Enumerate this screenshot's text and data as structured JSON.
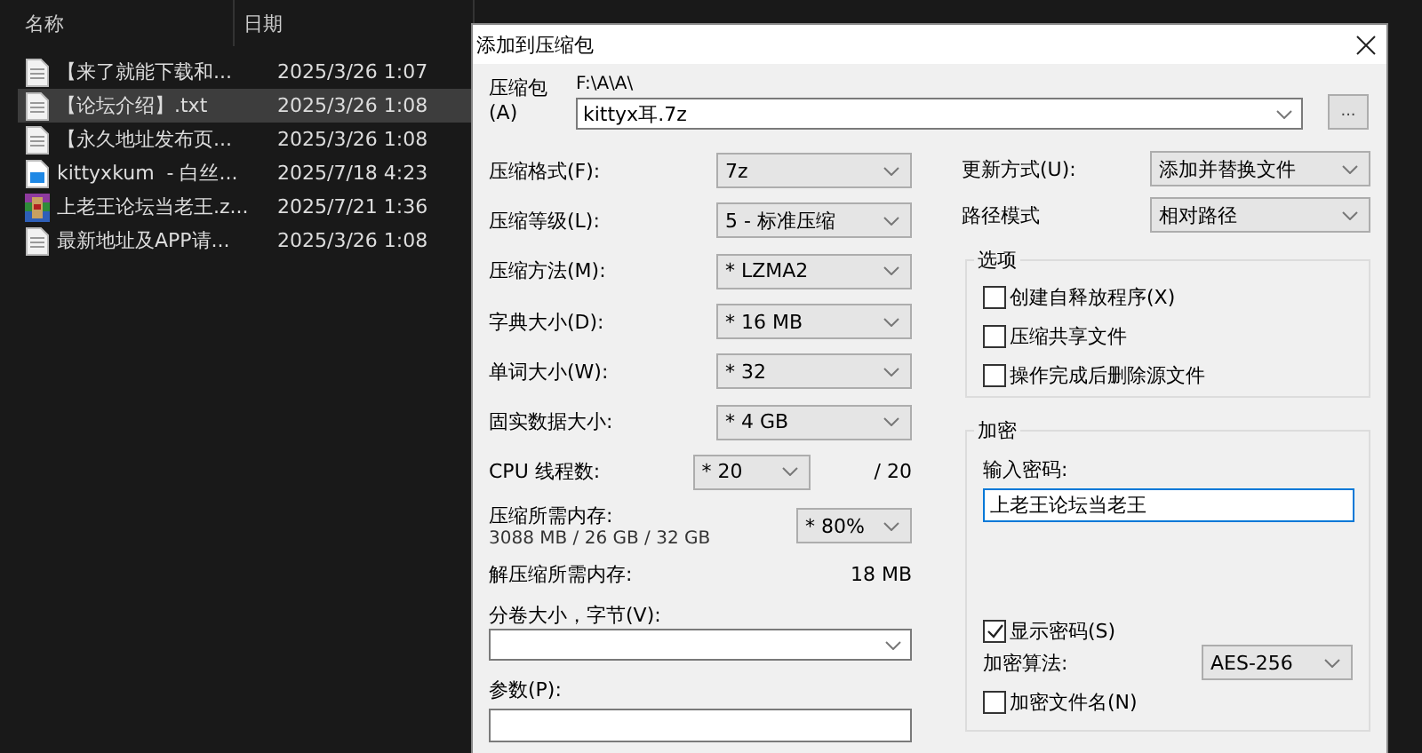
{
  "explorer": {
    "columns": [
      "名称",
      "日期"
    ],
    "files": [
      {
        "name": "【来了就能下载和...",
        "date": "2025/3/26 1:07",
        "kind": "text",
        "selected": false
      },
      {
        "name": "【论坛介绍】.txt",
        "date": "2025/3/26 1:08",
        "kind": "text",
        "selected": true
      },
      {
        "name": "【永久地址发布页...",
        "date": "2025/3/26 1:08",
        "kind": "text",
        "selected": false
      },
      {
        "name": "kittyxkum  - 白丝...",
        "date": "2025/7/18 4:23",
        "kind": "document",
        "selected": false
      },
      {
        "name": "上老王论坛当老王.z...",
        "date": "2025/7/21 1:36",
        "kind": "archive",
        "selected": false
      },
      {
        "name": "最新地址及APP请...",
        "date": "2025/3/26 1:08",
        "kind": "text",
        "selected": false
      }
    ]
  },
  "dialog": {
    "title": "添加到压缩包",
    "archive": {
      "label": "压缩包(A)",
      "path": "F:\\A\\A\\",
      "value": "kittyx耳.7z",
      "browse": "..."
    },
    "left_fields": [
      {
        "label": "压缩格式(F):",
        "value": "7z"
      },
      {
        "label": "压缩等级(L):",
        "value": "5 - 标准压缩"
      },
      {
        "label": "压缩方法(M):",
        "value": "* LZMA2"
      },
      {
        "label": "字典大小(D):",
        "value": "* 16 MB"
      },
      {
        "label": "单词大小(W):",
        "value": "* 32"
      },
      {
        "label": "固实数据大小:",
        "value": "* 4 GB"
      }
    ],
    "cpu": {
      "label": "CPU 线程数:",
      "value": "* 20",
      "total": "/ 20"
    },
    "memory": {
      "label": "压缩所需内存:",
      "detail": "3088 MB / 26 GB / 32 GB",
      "value": "* 80%"
    },
    "decompress_memory": {
      "label": "解压缩所需内存:",
      "value": "18 MB"
    },
    "split": {
      "label": "分卷大小，字节(V):"
    },
    "parameters": {
      "label": "参数(P):"
    },
    "right_fields": [
      {
        "label": "更新方式(U):",
        "value": "添加并替换文件"
      },
      {
        "label": "路径模式",
        "value": "相对路径"
      }
    ],
    "options": {
      "title": "选项",
      "items": [
        {
          "label": "创建自释放程序(X)",
          "checked": false
        },
        {
          "label": "压缩共享文件",
          "checked": false
        },
        {
          "label": "操作完成后删除源文件",
          "checked": false
        }
      ]
    },
    "encryption": {
      "title": "加密",
      "password_label": "输入密码:",
      "password": "上老王论坛当老王",
      "show_password": {
        "label": "显示密码(S)",
        "checked": true
      },
      "method_label": "加密算法:",
      "method": "AES-256",
      "encrypt_names": {
        "label": "加密文件名(N)",
        "checked": false
      }
    }
  }
}
